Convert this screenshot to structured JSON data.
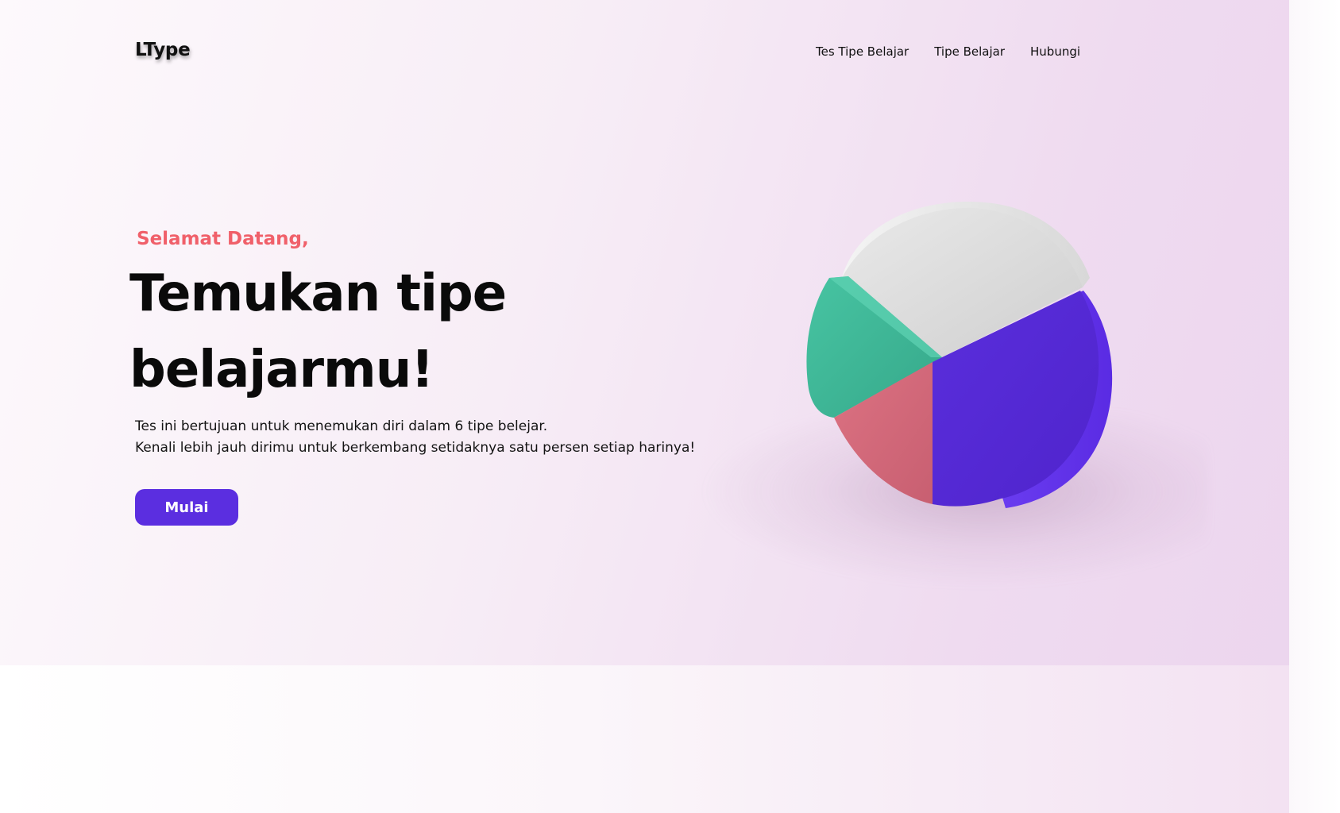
{
  "header": {
    "brand": "LType",
    "nav": [
      "Tes Tipe Belajar",
      "Tipe Belajar",
      "Hubungi"
    ]
  },
  "hero": {
    "greeting": "Selamat Datang,",
    "headline_line1": "Temukan tipe",
    "headline_line2": "belajarmu!",
    "desc_line1": "Tes ini bertujuan untuk menemukan diri dalam 6 tipe belejar.",
    "desc_line2": "Kenali lebih jauh dirimu untuk berkembang setidaknya satu persen setiap harinya!",
    "cta": "Mulai"
  },
  "illustration": {
    "icon": "pie-chart-3d-illustration",
    "colors": {
      "white_slice": "#dcdcdc",
      "purple_slice": "#5b2ee0",
      "teal_slice": "#42b99a",
      "pink_slice": "#d4687a"
    }
  },
  "colors": {
    "accent": "#5b2ee0",
    "greeting": "#f0606a",
    "text": "#0a0a0a"
  }
}
